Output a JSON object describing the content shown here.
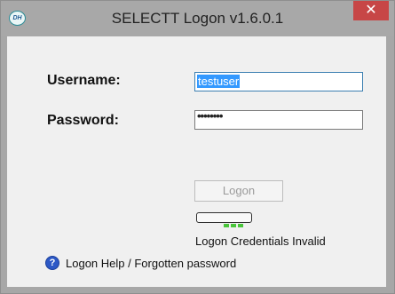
{
  "window": {
    "title": "SELECTT Logon v1.6.0.1",
    "app_icon_text": "DH",
    "close_symbol": "✕"
  },
  "form": {
    "username_label": "Username:",
    "username_value": "testuser",
    "password_label": "Password:",
    "password_value": "••••••••"
  },
  "logon_button": {
    "label": "Logon"
  },
  "progress": {
    "visible_fill": 0.48
  },
  "status": {
    "text": "Logon Credentials Invalid"
  },
  "help": {
    "icon_text": "?",
    "link_text": "Logon Help / Forgotten password"
  },
  "colors": {
    "titlebar": "#a8a8a8",
    "close_button": "#c74646",
    "selection": "#3399ff",
    "progress_green": "#49c53a",
    "help_icon": "#2d59c6"
  },
  "icons": {
    "app": "dh-logo-icon",
    "close": "close-icon",
    "help": "help-icon"
  }
}
